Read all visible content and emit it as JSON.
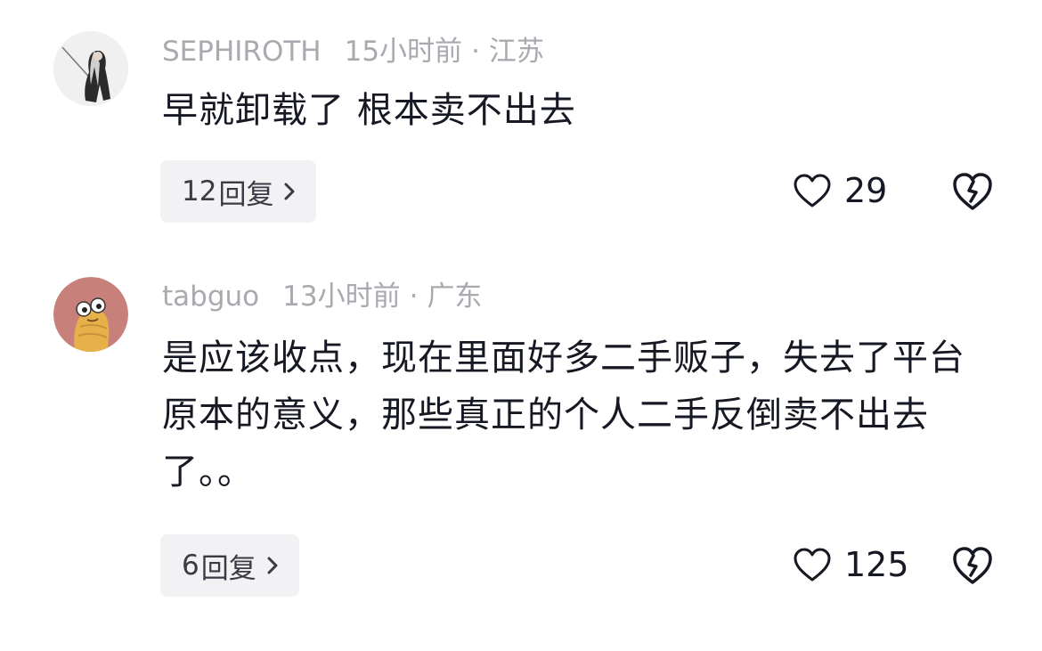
{
  "comments": [
    {
      "username": "SEPHIROTH",
      "time": "15小时前",
      "separator": "·",
      "location": "江苏",
      "text": "早就卸载了 根本卖不出去",
      "replies_count": "12",
      "replies_label": "回复",
      "likes": "29",
      "avatar_icon": "sephiroth-avatar"
    },
    {
      "username": "tabguo",
      "time": "13小时前",
      "separator": "·",
      "location": "广东",
      "text": "是应该收点，现在里面好多二手贩子，失去了平台原本的意义，那些真正的个人二手反倒卖不出去了。。",
      "replies_count": "6",
      "replies_label": "回复",
      "likes": "125",
      "avatar_icon": "cartoon-avatar"
    }
  ],
  "icons": {
    "like": "heart-outline-icon",
    "dislike": "broken-heart-icon",
    "reply_chevron": "chevron-right-icon"
  },
  "colors": {
    "meta_text": "#a9aab0",
    "body_text": "#161823",
    "reply_bg": "#f2f2f4"
  }
}
